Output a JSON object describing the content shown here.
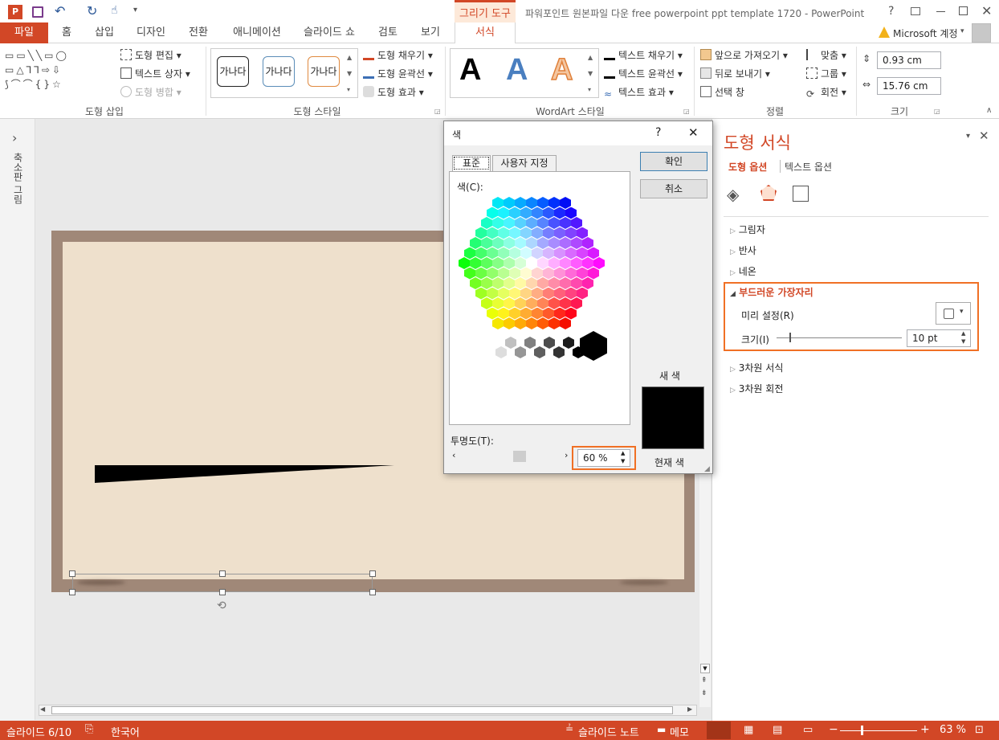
{
  "title_bar": {
    "window_title": "파워포인트 원본파일 다운 free powerpoint ppt template 1720 - PowerPoint",
    "context_tab_group": "그리기 도구",
    "help": "?"
  },
  "tabs": [
    {
      "label": "파일"
    },
    {
      "label": "홈"
    },
    {
      "label": "삽입"
    },
    {
      "label": "디자인"
    },
    {
      "label": "전환"
    },
    {
      "label": "애니메이션"
    },
    {
      "label": "슬라이드 쇼"
    },
    {
      "label": "검토"
    },
    {
      "label": "보기"
    },
    {
      "label": "서식"
    }
  ],
  "account": "Microsoft 계정",
  "ribbon": {
    "shape_insert": {
      "edit_shape": "도형 편집",
      "text_box": "텍스트 상자",
      "merge_shapes": "도형 병합",
      "label": "도형 삽입"
    },
    "shape_styles": {
      "samples": [
        "가나다",
        "가나다",
        "가나다"
      ],
      "fill": "도형 채우기",
      "outline": "도형 윤곽선",
      "effects": "도형 효과",
      "label": "도형 스타일"
    },
    "wordart": {
      "samples": [
        "A",
        "A",
        "A"
      ],
      "text_fill": "텍스트 채우기",
      "text_outline": "텍스트 윤곽선",
      "text_effects": "텍스트 효과",
      "label": "WordArt 스타일"
    },
    "arrange": {
      "bring_forward": "앞으로 가져오기",
      "send_backward": "뒤로 보내기",
      "selection_pane": "선택 창",
      "align": "맞춤",
      "group": "그룹",
      "rotate": "회전",
      "label": "정렬"
    },
    "size": {
      "height": "0.93 cm",
      "width": "15.76 cm",
      "label": "크기"
    }
  },
  "left_strip": {
    "label": "축소판 그림",
    "expand": "›"
  },
  "color_dialog": {
    "title": "색",
    "help": "?",
    "close": "✕",
    "tab_standard": "표준",
    "tab_custom": "사용자 지정",
    "colors_label": "색(C):",
    "ok": "확인",
    "cancel": "취소",
    "new_label": "새 색",
    "current_label": "현재 색",
    "transparency_label": "투명도(T):",
    "transparency_value": "60 %",
    "new_color": "#000000"
  },
  "format_pane": {
    "title": "도형 서식",
    "tab_shape": "도형 옵션",
    "tab_text": "텍스트 옵션",
    "sections": [
      {
        "label": "그림자",
        "expanded": false
      },
      {
        "label": "반사",
        "expanded": false
      },
      {
        "label": "네온",
        "expanded": false
      },
      {
        "label": "부드러운 가장자리",
        "expanded": true
      },
      {
        "label": "3차원 서식",
        "expanded": false
      },
      {
        "label": "3차원 회전",
        "expanded": false
      }
    ],
    "soft_edges": {
      "preset_label": "미리 설정(R)",
      "size_label": "크기(I)",
      "size_value": "10 pt"
    }
  },
  "status_bar": {
    "slide": "슬라이드 6/10",
    "language": "한국어",
    "notes": "슬라이드 노트",
    "comments": "메모",
    "zoom": "63 %"
  },
  "colors": {
    "accent": "#d24726",
    "highlight": "#f07025",
    "slide_border": "#a08878",
    "slide_bg": "#eee0cc"
  }
}
